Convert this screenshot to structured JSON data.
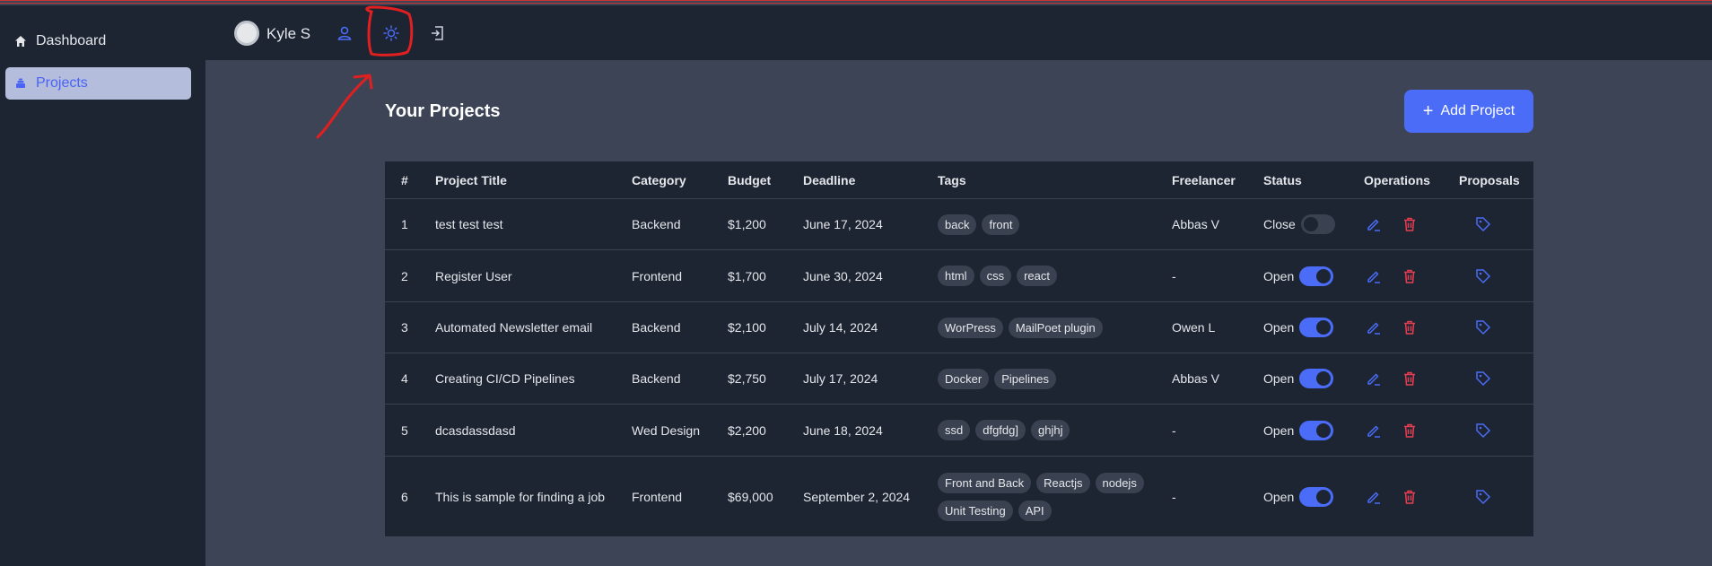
{
  "colors": {
    "accent": "#4a6cf7",
    "danger": "#e53e50",
    "sidebar_bg": "#1d2432",
    "page_bg": "#3c4455"
  },
  "sidebar": {
    "items": [
      {
        "label": "Dashboard",
        "icon": "home-icon"
      },
      {
        "label": "Projects",
        "icon": "layers-icon"
      }
    ]
  },
  "header": {
    "username": "Kyle S"
  },
  "main": {
    "title": "Your Projects",
    "add_label": "Add Project",
    "table": {
      "headers": [
        "#",
        "Project Title",
        "Category",
        "Budget",
        "Deadline",
        "Tags",
        "Freelancer",
        "Status",
        "Operations",
        "Proposals"
      ],
      "rows": [
        {
          "num": "1",
          "title": "test test test",
          "category": "Backend",
          "budget": "$1,200",
          "deadline": "June 17, 2024",
          "tags": [
            "back",
            "front"
          ],
          "freelancer": "Abbas V",
          "status": "Close",
          "status_on": false
        },
        {
          "num": "2",
          "title": "Register User",
          "category": "Frontend",
          "budget": "$1,700",
          "deadline": "June 30, 2024",
          "tags": [
            "html",
            "css",
            "react"
          ],
          "freelancer": "-",
          "status": "Open",
          "status_on": true
        },
        {
          "num": "3",
          "title": "Automated Newsletter email",
          "category": "Backend",
          "budget": "$2,100",
          "deadline": "July 14, 2024",
          "tags": [
            "WorPress",
            "MailPoet plugin"
          ],
          "freelancer": "Owen L",
          "status": "Open",
          "status_on": true
        },
        {
          "num": "4",
          "title": "Creating CI/CD Pipelines",
          "category": "Backend",
          "budget": "$2,750",
          "deadline": "July 17, 2024",
          "tags": [
            "Docker",
            "Pipelines"
          ],
          "freelancer": "Abbas V",
          "status": "Open",
          "status_on": true
        },
        {
          "num": "5",
          "title": "dcasdassdasd",
          "category": "Wed Design",
          "budget": "$2,200",
          "deadline": "June 18, 2024",
          "tags": [
            "ssd",
            "dfgfdg]",
            "ghjhj"
          ],
          "freelancer": "-",
          "status": "Open",
          "status_on": true
        },
        {
          "num": "6",
          "title": "This is sample for finding a job",
          "category": "Frontend",
          "budget": "$69,000",
          "deadline": "September 2, 2024",
          "tags": [
            "Front and Back",
            "Reactjs",
            "nodejs",
            "Unit Testing",
            "API"
          ],
          "freelancer": "-",
          "status": "Open",
          "status_on": true
        }
      ]
    }
  }
}
